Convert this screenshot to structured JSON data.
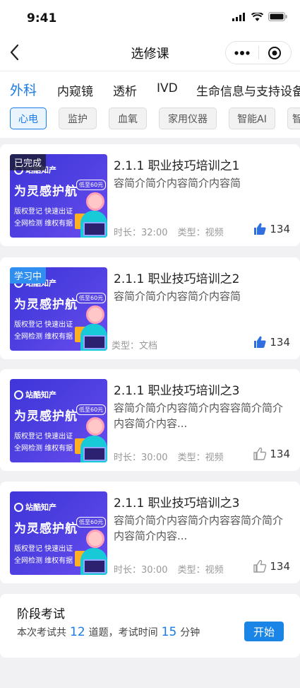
{
  "status": {
    "time": "9:41"
  },
  "nav": {
    "title": "选修课"
  },
  "categories": [
    "外科",
    "内窥镜",
    "透析",
    "IVD",
    "生命信息与支持设备"
  ],
  "subcategories": [
    "心电",
    "监护",
    "血氧",
    "家用仪器",
    "智能AI",
    "智"
  ],
  "thumbnail": {
    "brand": "站酷知产",
    "slogan": "为灵感护航",
    "price": "低至60元",
    "line1": "版权登记 快速出证",
    "line2": "全网检测 维权有据"
  },
  "courses": [
    {
      "title": "2.1.1 职业技巧培训之1",
      "description": "容简介简介内容简介内容简",
      "badge": "已完成",
      "duration_label": "时长：",
      "duration": "32:00",
      "type_label": "类型：",
      "type": "视频",
      "likes": "134",
      "liked": true
    },
    {
      "title": "2.1.1 职业技巧培训之2",
      "description": "容简介简介内容简介内容简",
      "badge": "学习中",
      "duration_label": "",
      "duration": "",
      "type_label": "类型：",
      "type": "文档",
      "likes": "134",
      "liked": true
    },
    {
      "title": "2.1.1 职业技巧培训之3",
      "description": "容简介简介内容简介内容容简介简介内容简介内容...",
      "badge": "",
      "duration_label": "时长：",
      "duration": "30:00",
      "type_label": "类型：",
      "type": "视频",
      "likes": "134",
      "liked": false
    },
    {
      "title": "2.1.1 职业技巧培训之3",
      "description": "容简介简介内容简介内容容简介简介内容简介内容...",
      "badge": "",
      "duration_label": "时长：",
      "duration": "30:00",
      "type_label": "类型：",
      "type": "视频",
      "likes": "134",
      "liked": false
    }
  ],
  "exam": {
    "title": "阶段考试",
    "text_part1": "本次考试共",
    "question_count": "12",
    "text_part2": "道题，考试时间",
    "minutes": "15",
    "text_part3": "分钟",
    "start_label": "开始"
  },
  "colors": {
    "accent": "#1a7be8",
    "liked": "#2f6fe0",
    "unliked": "#9a9a9a"
  }
}
